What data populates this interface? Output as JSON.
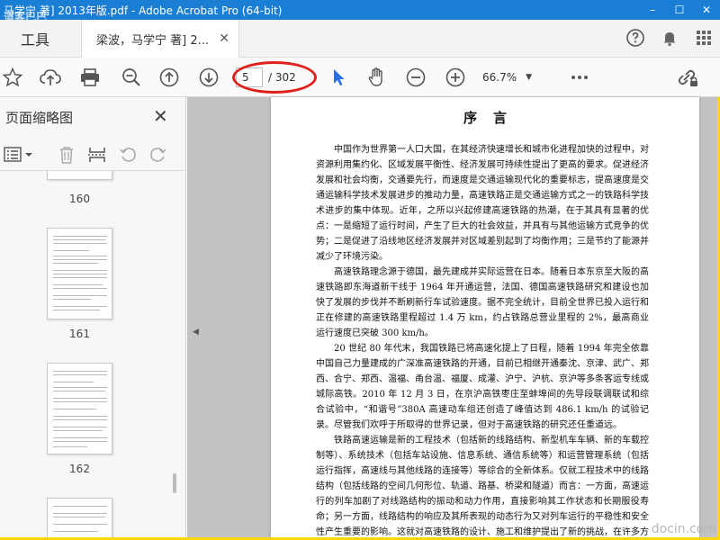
{
  "window": {
    "title": "马学宁 著] 2013年版.pdf - Adobe Acrobat Pro (64-bit)",
    "watermark_topleft": "道客巴巴",
    "controls": [
      "–",
      "☐",
      "✕"
    ]
  },
  "tabs": {
    "tool_label": "工具",
    "doc_label": "梁波，马学宁 著] 2...",
    "close_glyph": "✕"
  },
  "toolbar": {
    "page_current": "5",
    "page_total": "/ 302",
    "zoom": "66.7%"
  },
  "panel": {
    "title": "页面缩略图",
    "close_glyph": "✕",
    "thumbnails": [
      {
        "label": "160"
      },
      {
        "label": "161"
      },
      {
        "label": "162"
      }
    ]
  },
  "document": {
    "heading": "序言",
    "paragraphs": [
      "中国作为世界第一人口大国，在其经济快速增长和城市化进程加快的过程中，对资源利用集约化、区域发展平衡性、经济发展可持续性提出了更高的要求。促进经济发展和社会均衡，交通要先行，而速度是交通运输现代化的重要标志，提高速度是交通运输科学技术发展进步的推动力量，高速铁路正是交通运输方式之一的铁路科学技术进步的集中体现。近年，之所以兴起修建高速铁路的热潮，在于其具有显著的优点：一是缩短了运行时间，产生了巨大的社会效益，并具有与其他运输方式竞争的优势；二是促进了沿线地区经济发展并对区域差别起到了均衡作用；三是节约了能源并减少了环境污染。",
      "高速铁路理念源于德国，最先建成并实际运营在日本。随着日本东京至大阪的高速铁路即东海道新干线于 1964 年开通运营，法国、德国高速铁路研究和建设也加快了发展的步伐并不断刷新行车试验速度。据不完全统计，目前全世界已投入运行和正在修建的高速铁路里程超过 1.4 万 km，约占铁路总营业里程的 2%，最高商业运行速度已突破 300 km/h。",
      "20 世纪 80 年代末，我国铁路已将高速化提上了日程，随着 1994 年完全依靠中国自己力量建成的广深准高速铁路的开通，目前已相继开通秦沈、京津、武广、郑西、合宁、郑西、温福、甬台温、福厦、成灌、沪宁、沪杭、京沪等多条客运专线或城际高铁。2010 年 12 月 3 日，在京沪高铁枣庄至蚌埠间的先导段联调联试和综合试验中，“和谐号”380A 高速动车组还创造了峰值达到 486.1 km/h 的试验记录。尽管我们欢呼于所取得的世界记录，但对于高速铁路的研究还任重道远。",
      "铁路高速运输是新的工程技术（包括新的线路结构、新型机车车辆、新的车载控制等）、系统技术（包括车站设施、信息系统、通信系统等）和运营管理系统（包括运行指挥，高速线与其他线路的连接等）等综合的全新体系。仅就工程技术中的线路结构（包括线路的空间几何形位、轨道、路基、桥梁和隧道）而言：一方面，高速运行的列车加剧了对线路结构的振动和动力作用，直接影响其工作状态和长期服役寿命；另一方面，线路结构的响应及其所表现的动态行为又对列车运行的平稳性和安全性产生重要的影响。这就对高速铁路的设计、施工和维护提出了新的挑战，在许多方面深化和改变"
    ],
    "watermark": "docin.com"
  },
  "colors": {
    "titlebar": "#1a7fd4",
    "highlight_ellipse": "#e0201a",
    "cursor_blue": "#2b6fe0",
    "doc_background": "#c2c2c2"
  }
}
